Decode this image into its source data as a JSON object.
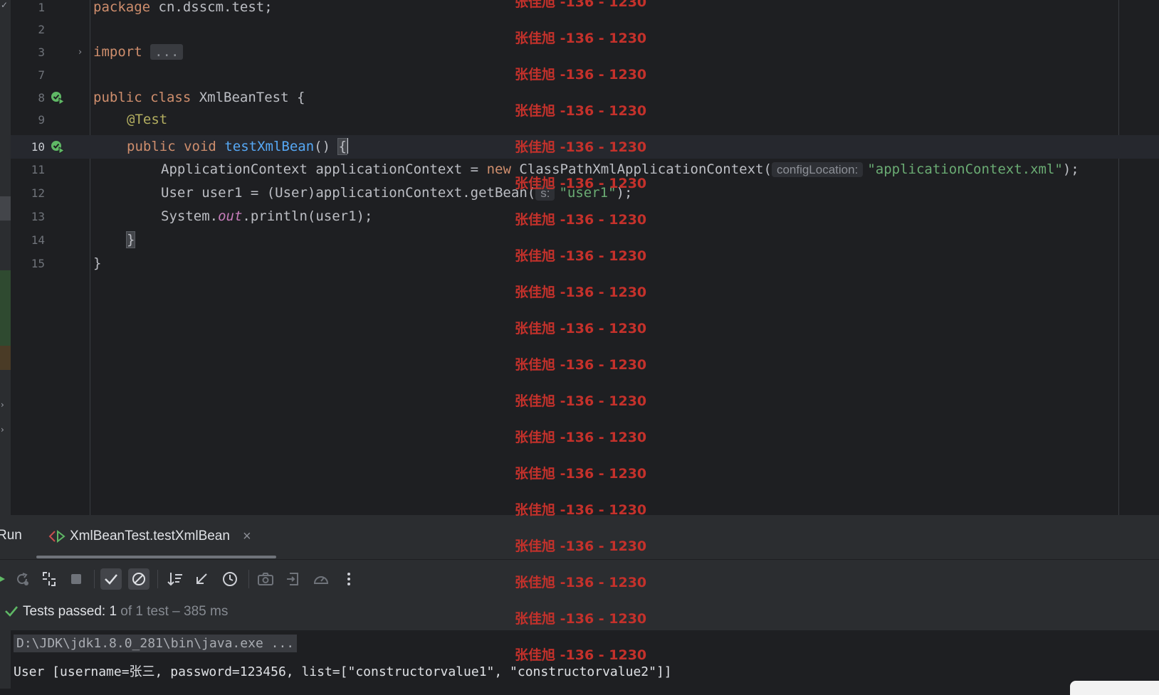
{
  "editor": {
    "lines": [
      {
        "num": "1"
      },
      {
        "num": "2"
      },
      {
        "num": "3"
      },
      {
        "num": "7"
      },
      {
        "num": "8"
      },
      {
        "num": "9"
      },
      {
        "num": "10"
      },
      {
        "num": "11"
      },
      {
        "num": "12"
      },
      {
        "num": "13"
      },
      {
        "num": "14"
      },
      {
        "num": "15"
      }
    ],
    "tokens": {
      "package_kw": "package",
      "package_name": " cn.dsscm.test;",
      "import_kw": "import",
      "import_folded": "...",
      "public_kw": "public",
      "class_kw": "class",
      "class_name": " XmlBeanTest {",
      "annotation": "@Test",
      "void_kw": "void",
      "method_name": "testXmlBean",
      "method_sig": "() ",
      "open_brace": "{",
      "line11_a": "ApplicationContext applicationContext = ",
      "new_kw": "new",
      "line11_b": " ClassPathXmlApplicationContext(",
      "hint_config": "configLocation:",
      "str_config": "\"applicationContext.xml\"",
      "line11_end": ");",
      "line12_a": "User user1 = (User)applicationContext.getBean(",
      "hint_s": "s:",
      "str_user1": "\"user1\"",
      "line12_end": ");",
      "line13_a": "System.",
      "line13_out": "out",
      "line13_b": ".println(user1);",
      "close_method": "}",
      "close_class": "}"
    }
  },
  "run": {
    "title": "Run",
    "tab_label": "XmlBeanTest.testXmlBean",
    "close_glyph": "×",
    "status_label": "Tests passed:",
    "status_count": " 1",
    "status_rest": " of 1 test – 385 ms",
    "console_cmd": "D:\\JDK\\jdk1.8.0_281\\bin\\java.exe ...",
    "console_out": "User [username=张三, password=123456, list=[\"constructorvalue1\", \"constructorvalue2\"]]"
  },
  "watermark": {
    "text": "张佳旭 -136 - 1230",
    "color": "#c4312b"
  },
  "colors": {
    "editor_bg": "#1e1f22",
    "panel_bg": "#2b2d30",
    "keyword": "#cf8e6d",
    "annotation": "#b3ae60",
    "function": "#56a8f5",
    "string": "#6aab73",
    "success": "#5fb865"
  }
}
